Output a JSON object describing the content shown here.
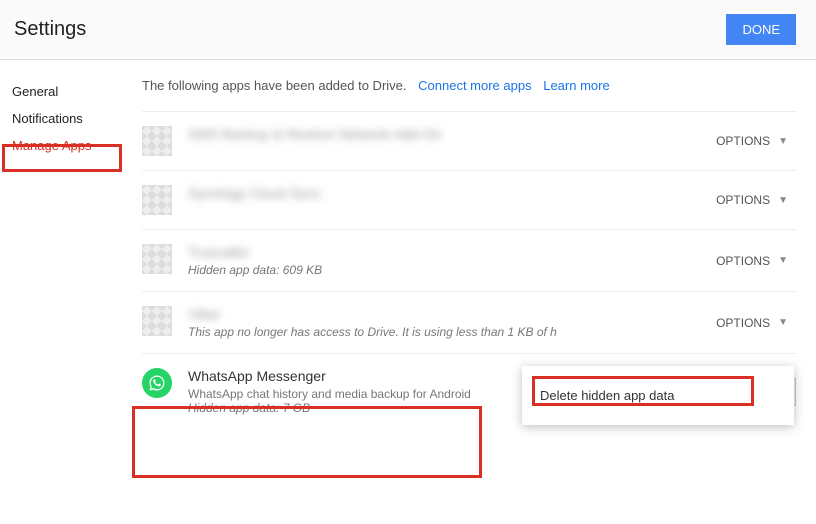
{
  "header": {
    "title": "Settings",
    "done": "DONE"
  },
  "sidebar": {
    "items": [
      {
        "label": "General"
      },
      {
        "label": "Notifications"
      },
      {
        "label": "Manage Apps"
      }
    ]
  },
  "intro": {
    "text": "The following apps have been added to Drive.",
    "link1": "Connect more apps",
    "link2": "Learn more"
  },
  "options_label": "OPTIONS",
  "apps": [
    {
      "title": "SMS Backup & Restore Network Add-On",
      "sub": ""
    },
    {
      "title": "Synology Cloud Sync",
      "sub": ""
    },
    {
      "title": "Truecaller",
      "sub": "Hidden app data: 609 KB"
    },
    {
      "title": "Viber",
      "sub": "This app no longer has access to Drive. It is using less than 1 KB of h"
    }
  ],
  "whatsapp": {
    "title": "WhatsApp Messenger",
    "desc": "WhatsApp chat history and media backup for Android",
    "sub": "Hidden app data: 7 GB"
  },
  "dropdown": {
    "item": "Delete hidden app data"
  }
}
